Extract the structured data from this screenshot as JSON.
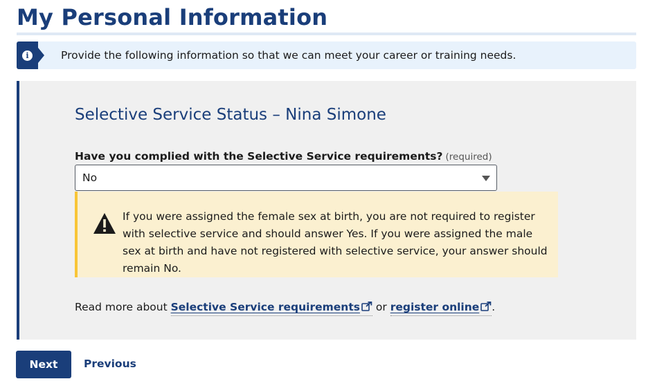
{
  "page": {
    "title": "My Personal Information"
  },
  "info_banner": {
    "icon": "info-icon",
    "text": "Provide the following information so that we can meet your career or training needs."
  },
  "section": {
    "heading": "Selective Service Status – Nina Simone",
    "field_label": "Have you complied with the Selective Service requirements?",
    "required_text": "(required)",
    "selected_value": "No"
  },
  "warning": {
    "icon": "warning-icon",
    "text": "If you were assigned the female sex at birth, you are not required to register with selective service and should answer Yes. If you were assigned the male sex at birth and have not registered with selective service, your answer should remain No."
  },
  "read_more": {
    "prefix": "Read more about ",
    "link1": "Selective Service requirements",
    "middle": " or ",
    "link2": "register online",
    "suffix": "."
  },
  "actions": {
    "next_label": "Next",
    "previous_label": "Previous"
  },
  "colors": {
    "brand": "#1a3e7a",
    "info_bg": "#e8f2fc",
    "panel_bg": "#f0f0f0",
    "warning_bg": "#fbf0d0",
    "warning_accent": "#f8c537"
  }
}
